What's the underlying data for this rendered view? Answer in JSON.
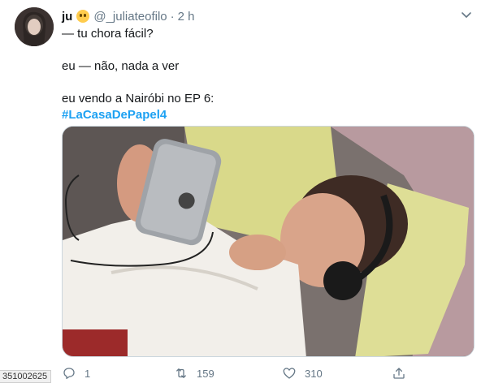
{
  "tweet": {
    "author_name": "ju",
    "author_emoji": "neutral-face-emoji",
    "handle": "@_juliateofilo",
    "separator": "·",
    "time": "2 h",
    "lines": [
      "— tu chora fácil?",
      "eu — não, nada a ver",
      "eu vendo a Nairóbi no EP 6:"
    ],
    "hashtag": "#LaCasaDePapel4"
  },
  "media": {
    "description_icon": "photo-crying-girl-with-phone"
  },
  "actions": {
    "reply_count": "1",
    "retweet_count": "159",
    "like_count": "310"
  },
  "edge_label": "351002625",
  "colors": {
    "link": "#1da1f2",
    "secondary_text": "#657786",
    "primary_text": "#14171a"
  }
}
